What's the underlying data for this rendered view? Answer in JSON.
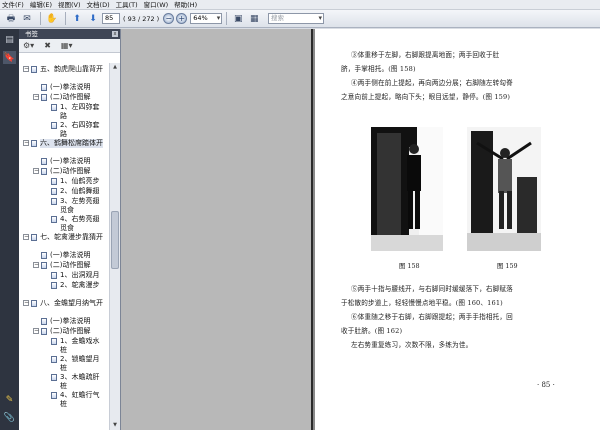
{
  "menu": [
    "文件(F)",
    "编辑(E)",
    "视图(V)",
    "文档(D)",
    "工具(T)",
    "窗口(W)",
    "帮助(H)"
  ],
  "toolbar": {
    "page_current": "85",
    "page_total": "( 93 / 272 )",
    "zoom_value": "64%",
    "search_placeholder": "搜索"
  },
  "panel": {
    "title": "书签",
    "close": "x"
  },
  "bookmarks": [
    {
      "label": "五、韵虎爬山靠背开",
      "level": 0,
      "exp": "−"
    },
    {
      "label": "(一)拳法说明",
      "level": 1,
      "exp": ""
    },
    {
      "label": "(二)动作图解",
      "level": 1,
      "exp": "−"
    },
    {
      "label": "1、左四弥套路",
      "level": 2,
      "exp": ""
    },
    {
      "label": "2、右四弥套路",
      "level": 2,
      "exp": ""
    },
    {
      "label": "六、鹤舞松席踏体开",
      "level": 0,
      "exp": "−"
    },
    {
      "label": "(一)拳法说明",
      "level": 1,
      "exp": ""
    },
    {
      "label": "(二)动作图解",
      "level": 1,
      "exp": "−"
    },
    {
      "label": "1、仙鹤亮步",
      "level": 2,
      "exp": ""
    },
    {
      "label": "2、仙鹤舞翅",
      "level": 2,
      "exp": ""
    },
    {
      "label": "3、左势亮翅觅食",
      "level": 2,
      "exp": ""
    },
    {
      "label": "4、右势亮翅觅食",
      "level": 2,
      "exp": ""
    },
    {
      "label": "七、鸵禽漫步靠猜开",
      "level": 0,
      "exp": "−"
    },
    {
      "label": "(一)拳法说明",
      "level": 1,
      "exp": ""
    },
    {
      "label": "(二)动作图解",
      "level": 1,
      "exp": "−"
    },
    {
      "label": "1、出洞观月",
      "level": 2,
      "exp": ""
    },
    {
      "label": "2、鸵禽漫步",
      "level": 2,
      "exp": ""
    },
    {
      "label": "八、金蟾望月纳气开",
      "level": 0,
      "exp": "−"
    },
    {
      "label": "(一)拳法说明",
      "level": 1,
      "exp": ""
    },
    {
      "label": "(二)动作图解",
      "level": 1,
      "exp": "−"
    },
    {
      "label": "1、金蟾戏水桩",
      "level": 2,
      "exp": ""
    },
    {
      "label": "2、锁蟾望月桩",
      "level": 2,
      "exp": ""
    },
    {
      "label": "3、木蟾疏肝桩",
      "level": 2,
      "exp": ""
    },
    {
      "label": "4、虹蟾行气桩",
      "level": 2,
      "exp": ""
    }
  ],
  "document": {
    "paragraph_1": [
      "③体重移于左脚，右脚跟提离地面；两手回收于肚",
      "脐，手掌相托。(图 158)",
      "④两手侧在前上提起，再向两边分展；右脚随左转勾脊",
      "之意向前上提起，略向下头；眼目远望，静停。(图 159)"
    ],
    "figure_captions": [
      "图 158",
      "图 159"
    ],
    "paragraph_2": [
      "⑤两手十指与腰线开，与右脚同时缓缓落下，右脚赋落",
      "于松散的步道上，轻轻慢慢点地平稳。(图 160、161)",
      "⑥体重随之移于右脚，右脚跟提起；两手手指相托，回",
      "收于肚脐。(图 162)",
      "左右势重复练习，次数不限，多练为佳。"
    ],
    "page_number": "· 85 ·"
  }
}
